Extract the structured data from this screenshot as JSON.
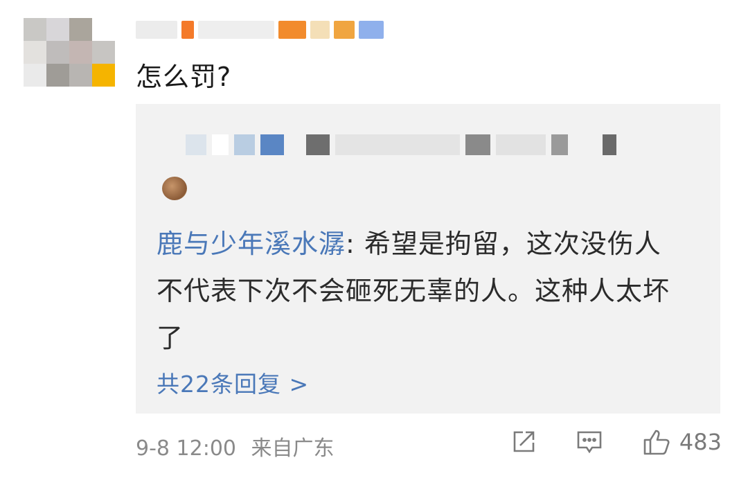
{
  "comment": {
    "text": "怎么罚?"
  },
  "reply": {
    "author": "鹿与少年溪水潺",
    "separator": ": ",
    "text": "希望是拘留，这次没伤人不代表下次不会砸死无辜的人。这种人太坏了",
    "count_label": "共22条回复 >"
  },
  "meta": {
    "timestamp": "9-8 12:00",
    "source": "来自广东"
  },
  "actions": {
    "share_icon": "share-icon",
    "comment_icon": "comment-icon",
    "like_icon": "thumbs-up-icon",
    "likes": "483"
  },
  "colors": {
    "link_blue": "#4a78b8",
    "quote_bg": "#f2f2f2",
    "meta_gray": "#8a8a8a"
  }
}
